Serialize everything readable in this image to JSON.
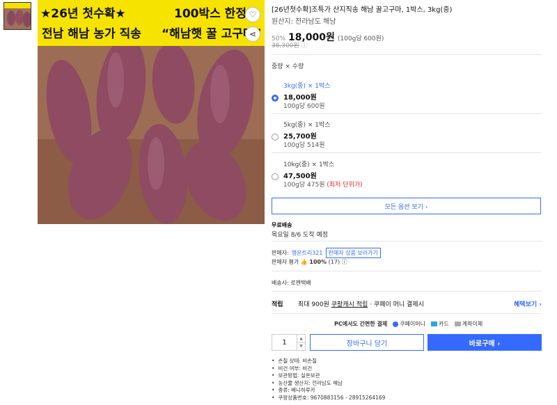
{
  "image": {
    "banner_line1_left": "★26년 첫수확★",
    "banner_line1_right": "100박스 한정",
    "banner_line2_left": "전남 해남 농가 직송",
    "banner_line2_right": "“해남햇 꿀 고구마”",
    "heart_icon": "♡",
    "share_icon": "⋖"
  },
  "product": {
    "title": "[26년첫수확]조특가 산지직송 해남 꿀고구마, 1박스, 3kg(중)",
    "origin": "원산지: 전라남도 해남",
    "discount": "50%",
    "price": "18,000원",
    "unit_price": "(100g당 600원)",
    "original_price": "36,300원",
    "info_icon": "ⓘ"
  },
  "options": {
    "label": "중량 × 수량",
    "items": [
      {
        "name": "3kg(중) × 1박스",
        "price": "18,000원",
        "unit": "100g당 600원",
        "note": ""
      },
      {
        "name": "5kg(중) × 1박스",
        "price": "25,700원",
        "unit": "100g당 514원",
        "note": ""
      },
      {
        "name": "10kg(중) × 1박스",
        "price": "47,500원",
        "unit": "100g당 475원",
        "note": "(최저 단위가)"
      }
    ],
    "all_button": "모든 옵션 보기 ›"
  },
  "shipping": {
    "title": "무료배송",
    "date": "목요일 8/6 도착 예정"
  },
  "seller": {
    "label": "판매자:",
    "name": "행운트리321",
    "button": "판매자 상품 보러가기",
    "rating_label": "판매자 평가",
    "rating_value": "100%",
    "rating_count": "(17)",
    "thumb_icon": "👍"
  },
  "delivery": "배송사: 로젠택배",
  "cashback": {
    "label": "적립",
    "text_pre": "최대 900원",
    "link": "쿠팡캐시 적립",
    "text_post": "· 쿠페이 머니 결제시",
    "more": "혜택보기 ›"
  },
  "payment": {
    "lead": "PC에서도 간편한 결제",
    "methods": [
      "쿠페이머니",
      "카드",
      "계좌이체"
    ]
  },
  "purchase": {
    "quantity": "1",
    "cart_label": "장바구니 담기",
    "buy_label": "바로구매 ›"
  },
  "specs": [
    "손질 상태: 비손질",
    "비건 여부: 비건",
    "보관방법: 실온보관",
    "농산물 생산지: 전라남도 해남",
    "종류: 베니하루카",
    "쿠팡상품번호: 9670883156 - 28915264169"
  ]
}
